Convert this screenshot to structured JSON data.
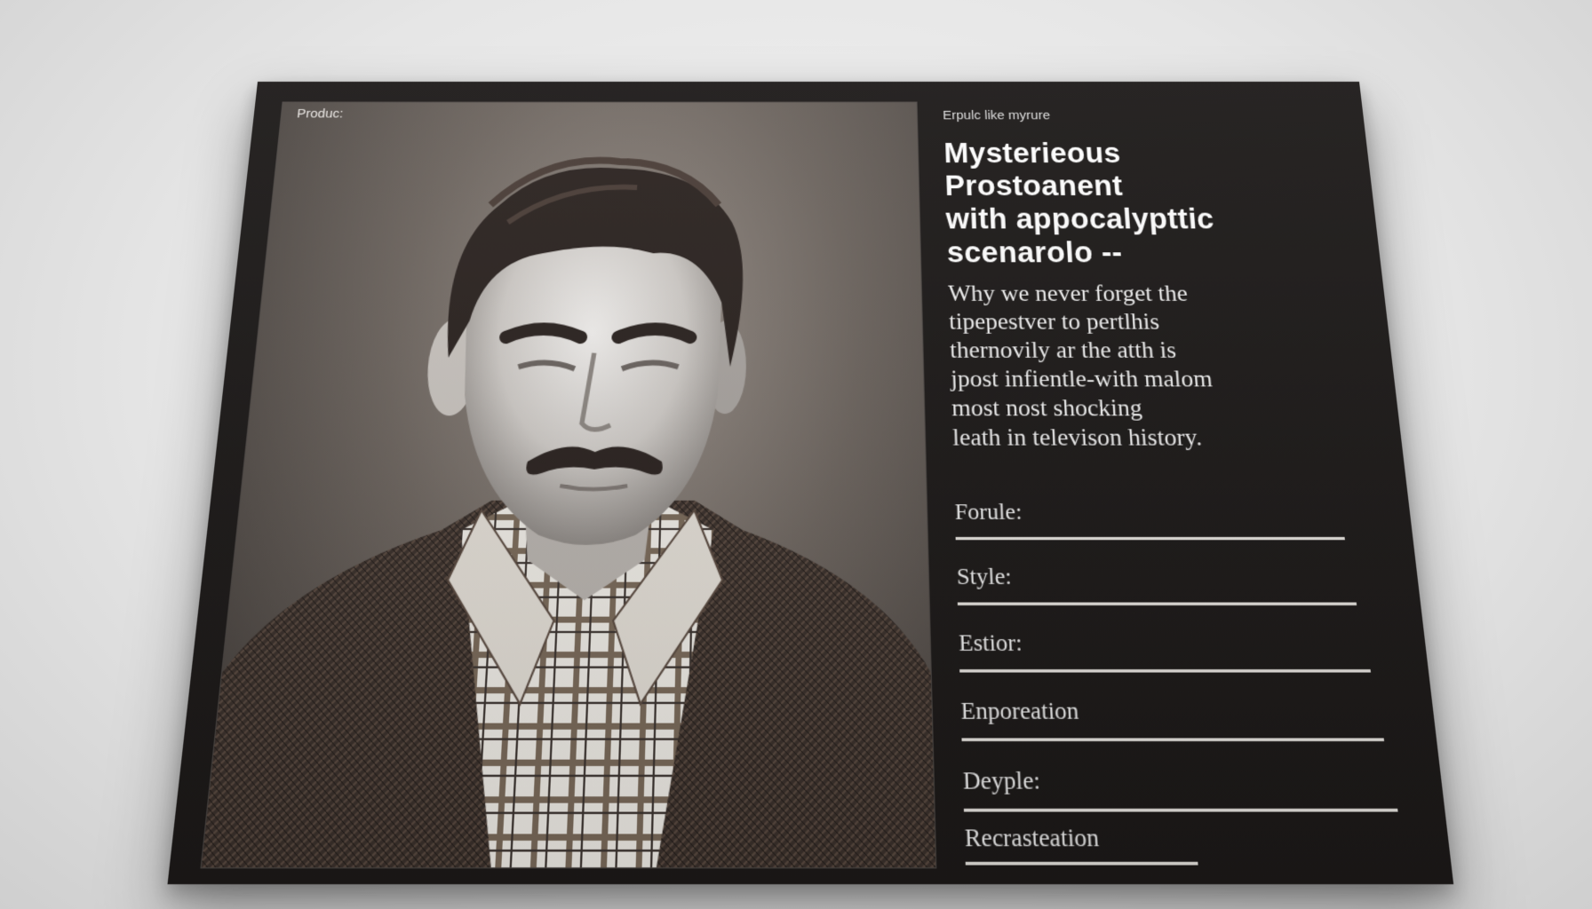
{
  "card": {
    "photo_label": "Produc:",
    "eyebrow": "Erpulc like myrure",
    "title_lines": [
      "Mysterieous",
      "Prostoanent",
      "with appocalypttic",
      "scenarolo --"
    ],
    "description_lines": [
      "Why we never forget the",
      "tipepestver to pertlhis",
      "thernovily ar the atth is",
      "jpost  infientle-with malom",
      "most nost shocking",
      "leath in televison  history."
    ],
    "fields": [
      "Forule:",
      "Style:",
      "Estior:",
      "Enporeation",
      "Deyple:",
      "Recrasteation"
    ]
  },
  "colors": {
    "card_background": "#1c1918",
    "text": "#ffffff",
    "rule": "#e6e3de"
  }
}
